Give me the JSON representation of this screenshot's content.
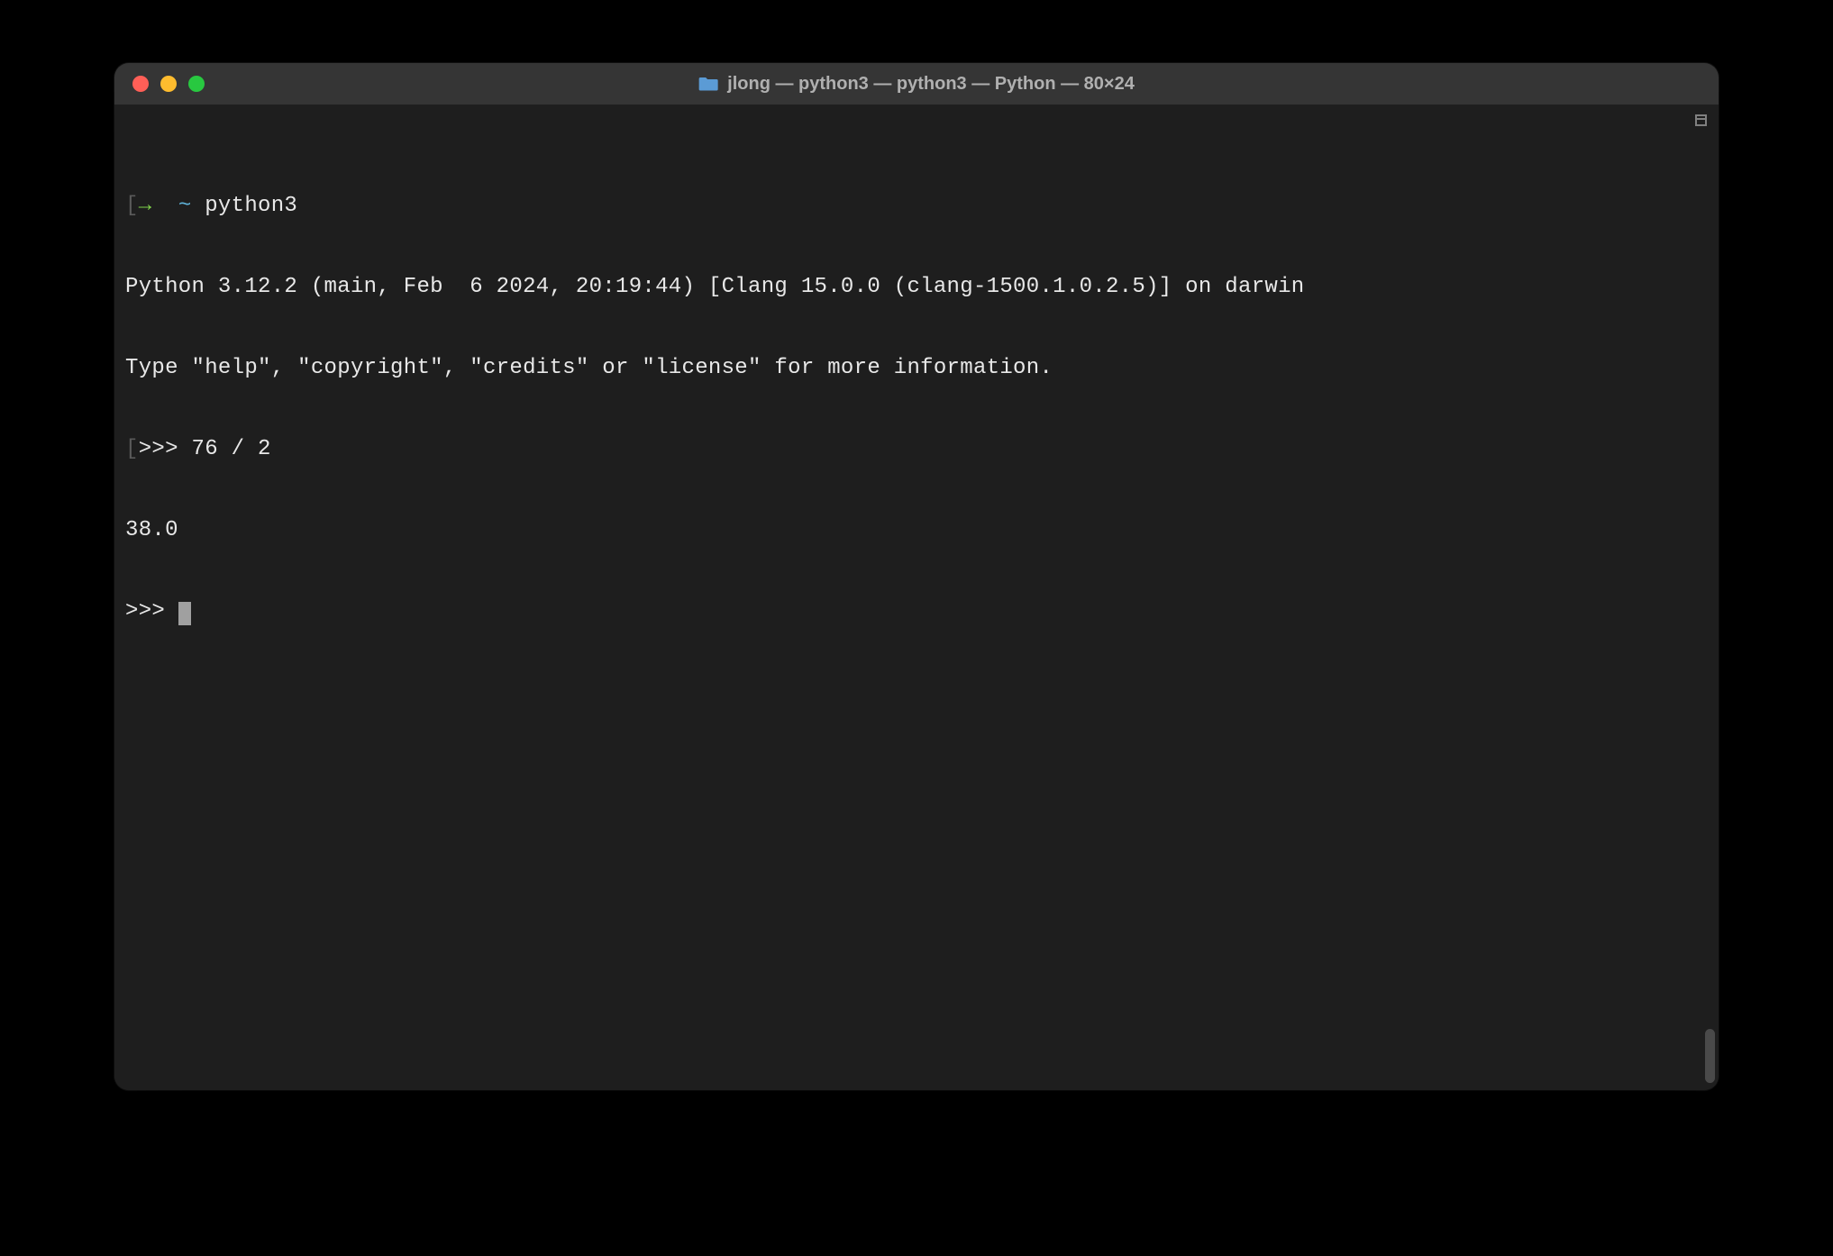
{
  "window": {
    "title": "jlong — python3 — python3 — Python — 80×24"
  },
  "terminal": {
    "shell_prompt": {
      "arrow": "→",
      "tilde": "~",
      "command": "python3"
    },
    "banner_line1": "Python 3.12.2 (main, Feb  6 2024, 20:19:44) [Clang 15.0.0 (clang-1500.1.0.2.5)] on darwin",
    "banner_line2": "Type \"help\", \"copyright\", \"credits\" or \"license\" for more information.",
    "repl_in_prefix": ">>> ",
    "repl_input": "76 / 2",
    "repl_output": "38.0",
    "repl_prompt_empty": ">>> "
  }
}
